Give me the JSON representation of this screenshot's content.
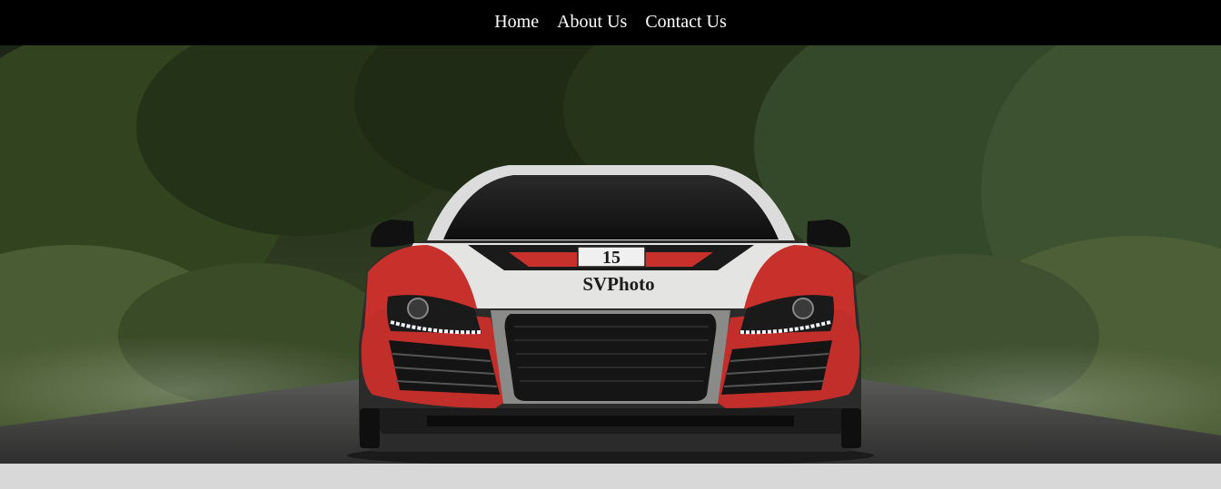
{
  "nav": {
    "items": [
      {
        "label": "Home"
      },
      {
        "label": "About Us"
      },
      {
        "label": "Contact Us"
      }
    ]
  },
  "hero": {
    "plate_number": "15",
    "decal_text": "SVPhoto",
    "colors": {
      "nav_bg": "#000000",
      "nav_text": "#ffffff",
      "car_red": "#c8302a",
      "car_white": "#e6e6e6",
      "forest": "#2c3a1f",
      "road": "#4a4a4a",
      "page_bg": "#d8d8d8"
    }
  }
}
